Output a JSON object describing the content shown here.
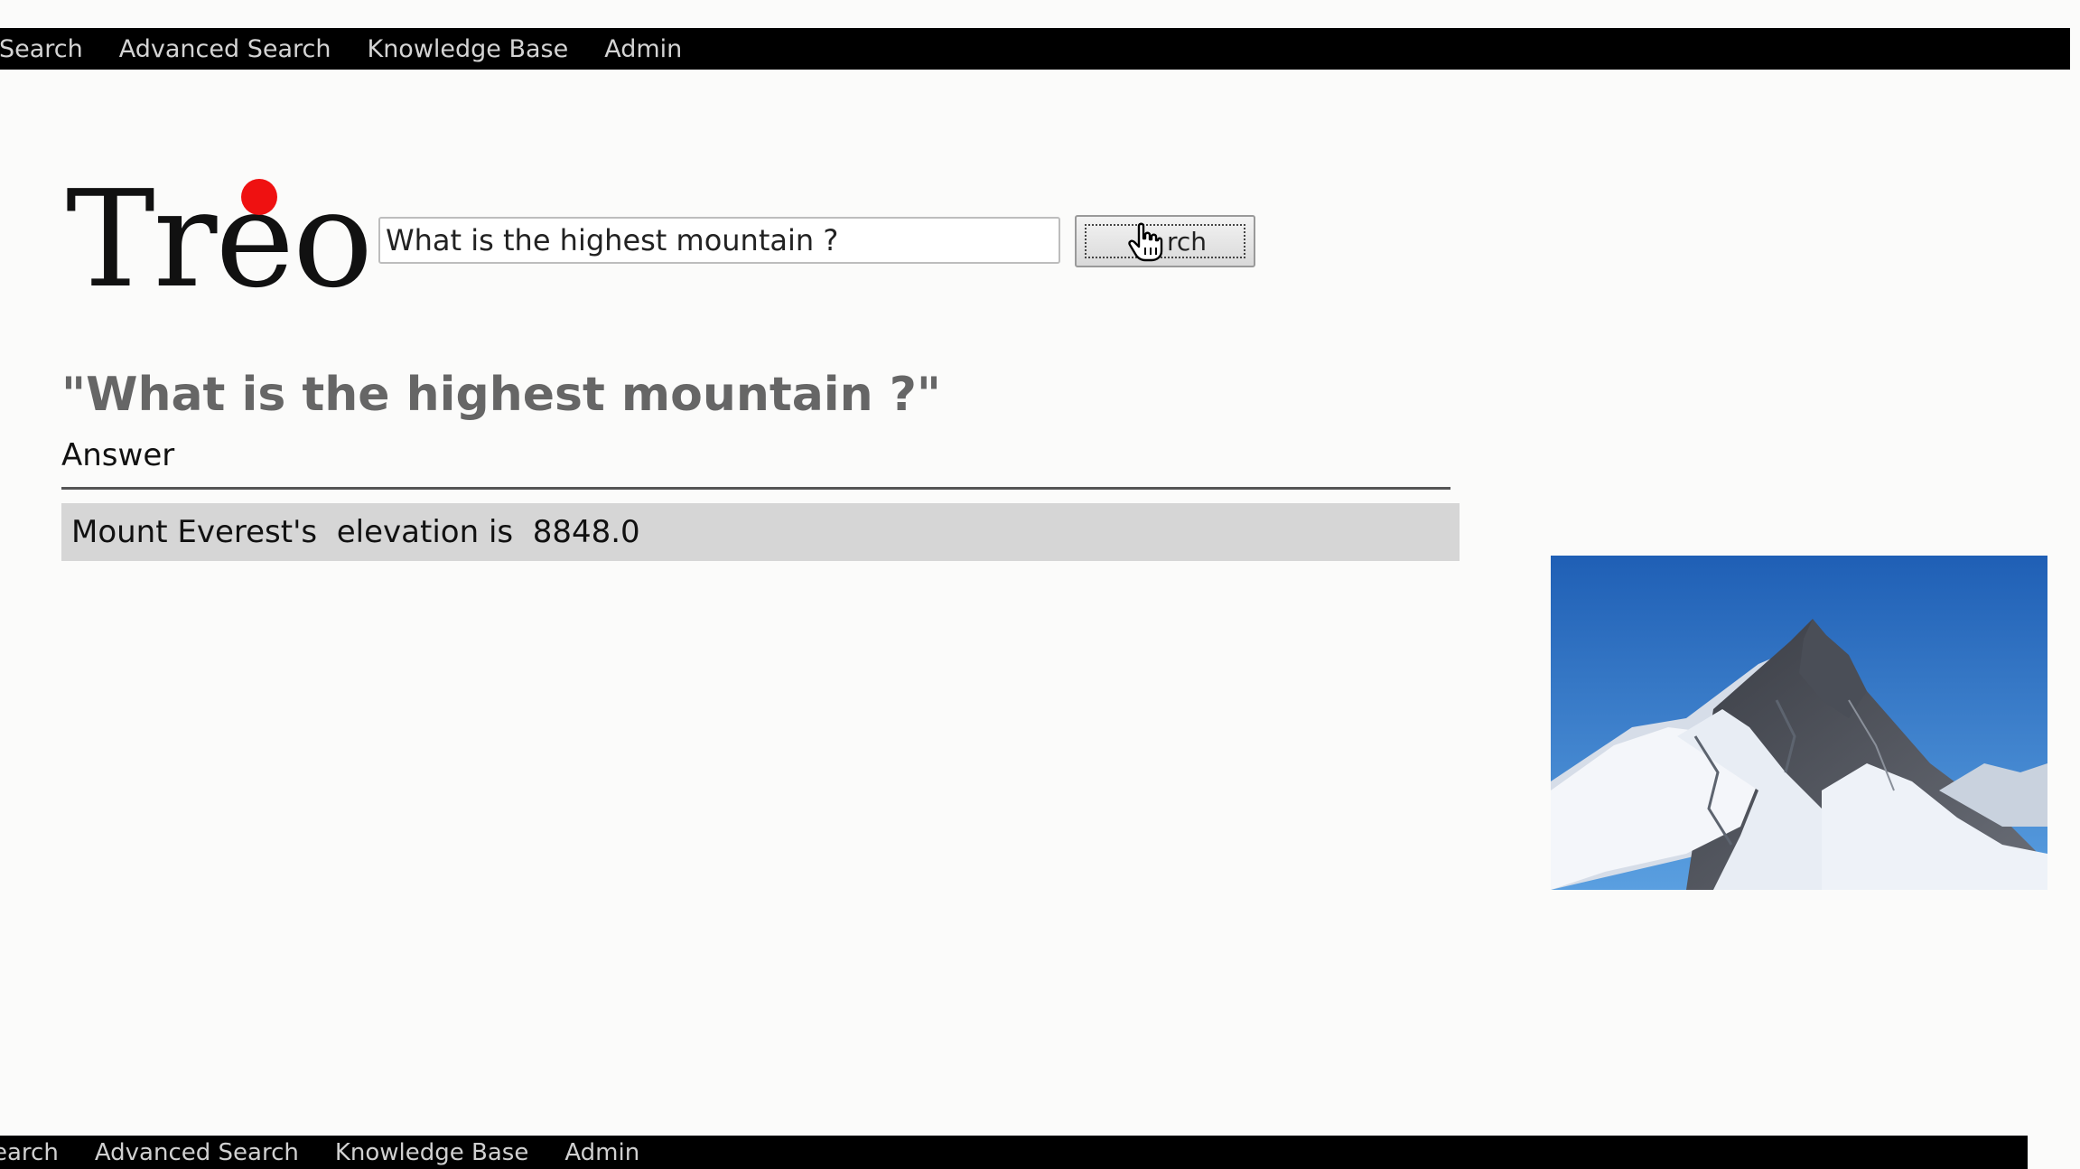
{
  "nav": {
    "items": [
      "Search",
      "Advanced Search",
      "Knowledge Base",
      "Admin"
    ]
  },
  "bottom_nav": {
    "items": [
      "earch",
      "Advanced Search",
      "Knowledge Base",
      "Admin"
    ]
  },
  "logo": {
    "text": "Treo",
    "dot_color": "#ef1111"
  },
  "search": {
    "value": "What is the highest mountain ?",
    "button_label": "rch"
  },
  "result": {
    "question": "\"What is the highest mountain ?\"",
    "answer_label": "Answer",
    "answer_text": "Mount Everest's  elevation is  8848.0"
  },
  "icons": {
    "cursor": "hand-pointer-icon",
    "image": "mountain-everest-photo"
  }
}
